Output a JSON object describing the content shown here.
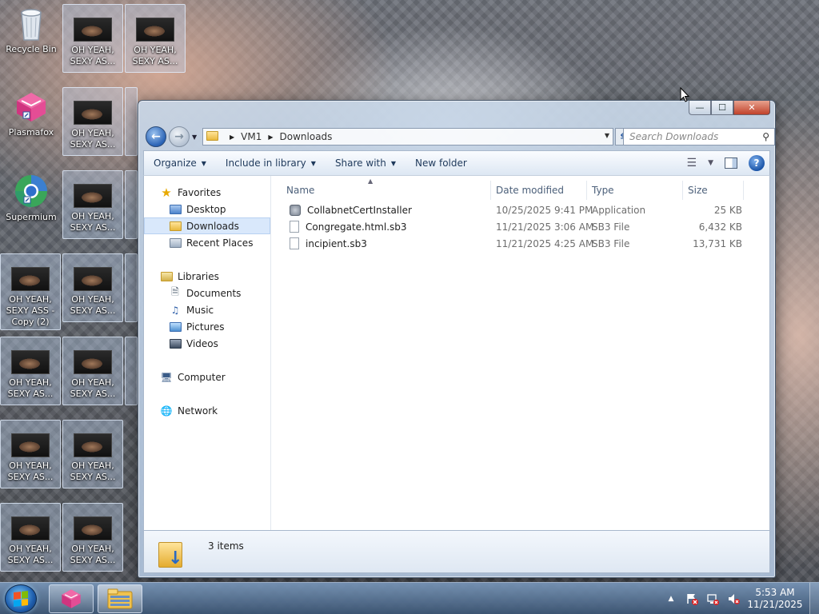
{
  "desktop": {
    "shortcuts": [
      {
        "label": "Recycle Bin"
      },
      {
        "label": "Plasmafox"
      },
      {
        "label": "Supermium"
      }
    ],
    "tile_label": "OH YEAH, SEXY AS...",
    "tile_label_copy": "OH YEAH, SEXY ASS - Copy (2)"
  },
  "window": {
    "caption": {
      "minimize": "—",
      "maximize": "☐",
      "close": "✕"
    },
    "breadcrumb": [
      "VM1",
      "Downloads"
    ],
    "search_placeholder": "Search Downloads",
    "commands": [
      {
        "label": "Organize",
        "has_menu": true
      },
      {
        "label": "Include in library",
        "has_menu": true
      },
      {
        "label": "Share with",
        "has_menu": true
      },
      {
        "label": "New folder",
        "has_menu": false
      }
    ],
    "nav": {
      "favorites": "Favorites",
      "favorites_items": [
        "Desktop",
        "Downloads",
        "Recent Places"
      ],
      "libraries": "Libraries",
      "libraries_items": [
        "Documents",
        "Music",
        "Pictures",
        "Videos"
      ],
      "computer": "Computer",
      "network": "Network",
      "selected": "Downloads"
    },
    "columns": [
      "Name",
      "Date modified",
      "Type",
      "Size"
    ],
    "files": [
      {
        "name": "CollabnetCertInstaller",
        "date": "10/25/2025 9:41 PM",
        "type": "Application",
        "size": "25 KB",
        "icon": "application-icon"
      },
      {
        "name": "Congregate.html.sb3",
        "date": "11/21/2025 3:06 AM",
        "type": "SB3 File",
        "size": "6,432 KB",
        "icon": "file-icon"
      },
      {
        "name": "incipient.sb3",
        "date": "11/21/2025 4:25 AM",
        "type": "SB3 File",
        "size": "13,731 KB",
        "icon": "file-icon"
      }
    ],
    "item_count": "3 items"
  },
  "taskbar": {
    "time": "5:53 AM",
    "date": "11/21/2025"
  }
}
